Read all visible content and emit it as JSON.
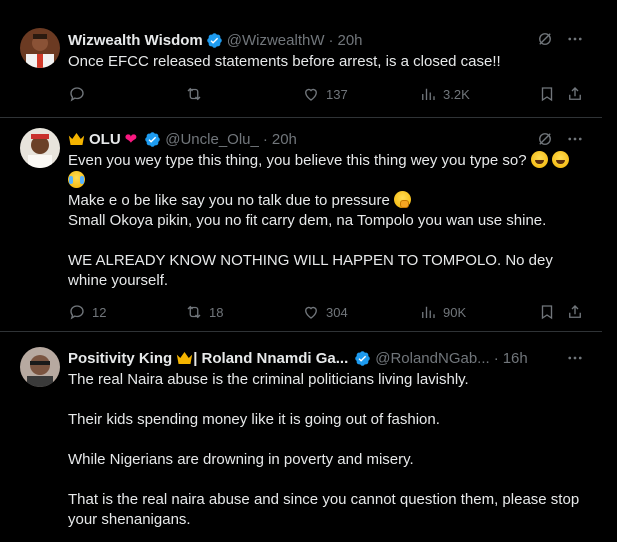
{
  "colors": {
    "accent": "#1d9bf0",
    "muted": "#71767b",
    "text": "#e7e9ea",
    "border": "#2f3336"
  },
  "tweets": [
    {
      "name": "Wizwealth Wisdom",
      "handle": "@WizwealthW",
      "time": "20h",
      "lines": [
        "Once EFCC released statements before arrest, is a closed case!!"
      ],
      "replies": "",
      "reposts": "",
      "likes": "137",
      "views": "3.2K"
    },
    {
      "name": "OLU",
      "handle": "@Uncle_Olu_",
      "time": "20h",
      "line1": "Even you wey type this thing, you believe this thing wey you type so? ",
      "line2_a": "Make e",
      "line2_b": " o be like say you no talk due to pressure ",
      "line3": "Small Okoya pikin, you no fit carry dem, na Tompolo you wan use shine.",
      "line4": "WE ALREADY KNOW NOTHING WILL HAPPEN TO TOMPOLO. No dey whine yourself.",
      "replies": "12",
      "reposts": "18",
      "likes": "304",
      "views": "90K"
    },
    {
      "name_a": "Positivity King",
      "name_b": " | Roland Nnamdi Ga...",
      "handle": "@RolandNGab...",
      "time": "16h",
      "p1": "The real Naira abuse is the criminal politicians living lavishly.",
      "p2": "Their kids spending money like it is going out of fashion.",
      "p3": "While Nigerians are drowning in poverty and misery.",
      "p4": "That is the real naira abuse and since you cannot question them, please stop your shenanigans."
    }
  ],
  "icons": [
    "grok-icon",
    "more-icon",
    "reply-icon",
    "repost-icon",
    "like-icon",
    "views-icon",
    "bookmark-icon",
    "share-icon",
    "verified-icon"
  ]
}
